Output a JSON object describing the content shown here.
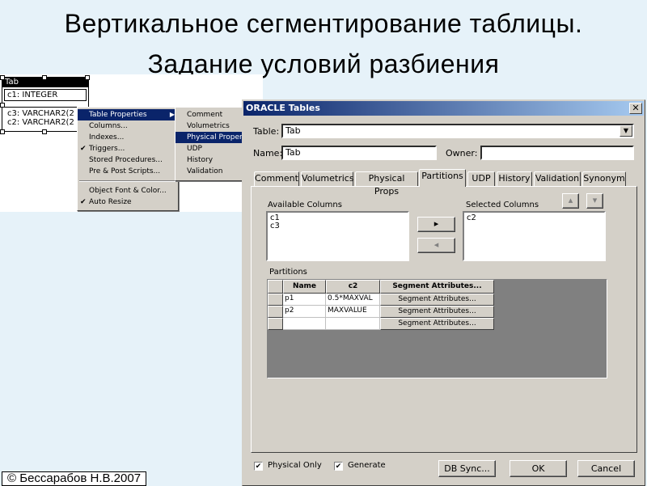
{
  "slide": {
    "title_line1": "Вертикальное сегментирование таблицы.",
    "title_line2": "Задание условий разбиения",
    "copyright": "© Бессарабов Н.В.2007"
  },
  "entity": {
    "name": "Tab",
    "columns": [
      "c1: INTEGER",
      "c3: VARCHAR2(2",
      "c2: VARCHAR2(2"
    ]
  },
  "context_menu": {
    "items": [
      {
        "label": "Table Properties",
        "checked": false,
        "submenu": true,
        "highlighted": true
      },
      {
        "label": "Columns...",
        "checked": false
      },
      {
        "label": "Indexes...",
        "checked": false
      },
      {
        "label": "Triggers...",
        "checked": true
      },
      {
        "label": "Stored Procedures...",
        "checked": false
      },
      {
        "label": "Pre & Post Scripts...",
        "checked": false
      },
      {
        "label": "Object Font & Color...",
        "checked": false
      },
      {
        "label": "Auto Resize",
        "checked": true
      }
    ]
  },
  "submenu": {
    "items": [
      "Comment",
      "Volumetrics",
      "Physical Property",
      "UDP",
      "History",
      "Validation"
    ],
    "highlighted": "Physical Property"
  },
  "dialog": {
    "title": "ORACLE Tables",
    "close_glyph": "✕",
    "table_label": "Table:",
    "table_value": "Tab",
    "name_label": "Name:",
    "name_value": "Tab",
    "owner_label": "Owner:",
    "owner_value": "",
    "tabs": [
      "Comment",
      "Volumetrics",
      "Physical Props",
      "Partitions",
      "UDP",
      "History",
      "Validation",
      "Synonym"
    ],
    "active_tab": "Partitions",
    "available_label": "Available Columns",
    "available_columns": [
      "c1",
      "c3"
    ],
    "selected_label": "Selected Columns",
    "selected_columns": [
      "c2"
    ],
    "move_right_glyph": "▸",
    "move_left_glyph": "◂",
    "move_up_glyph": "▴",
    "move_down_glyph": "▾",
    "partitions_label": "Partitions",
    "grid_headers": [
      "Name",
      "c2",
      "Segment Attributes..."
    ],
    "grid_rows": [
      {
        "name": "p1",
        "c2": "0.5*MAXVAL",
        "seg": "Segment Attributes..."
      },
      {
        "name": "p2",
        "c2": "MAXVALUE",
        "seg": "Segment Attributes..."
      },
      {
        "name": "",
        "c2": "",
        "seg": "Segment Attributes..."
      }
    ],
    "physical_only_label": "Physical Only",
    "physical_only_checked": true,
    "generate_label": "Generate",
    "generate_checked": true,
    "db_sync_label": "DB Sync...",
    "ok_label": "OK",
    "cancel_label": "Cancel",
    "dropdown_glyph": "▼",
    "check_glyph": "✔"
  }
}
